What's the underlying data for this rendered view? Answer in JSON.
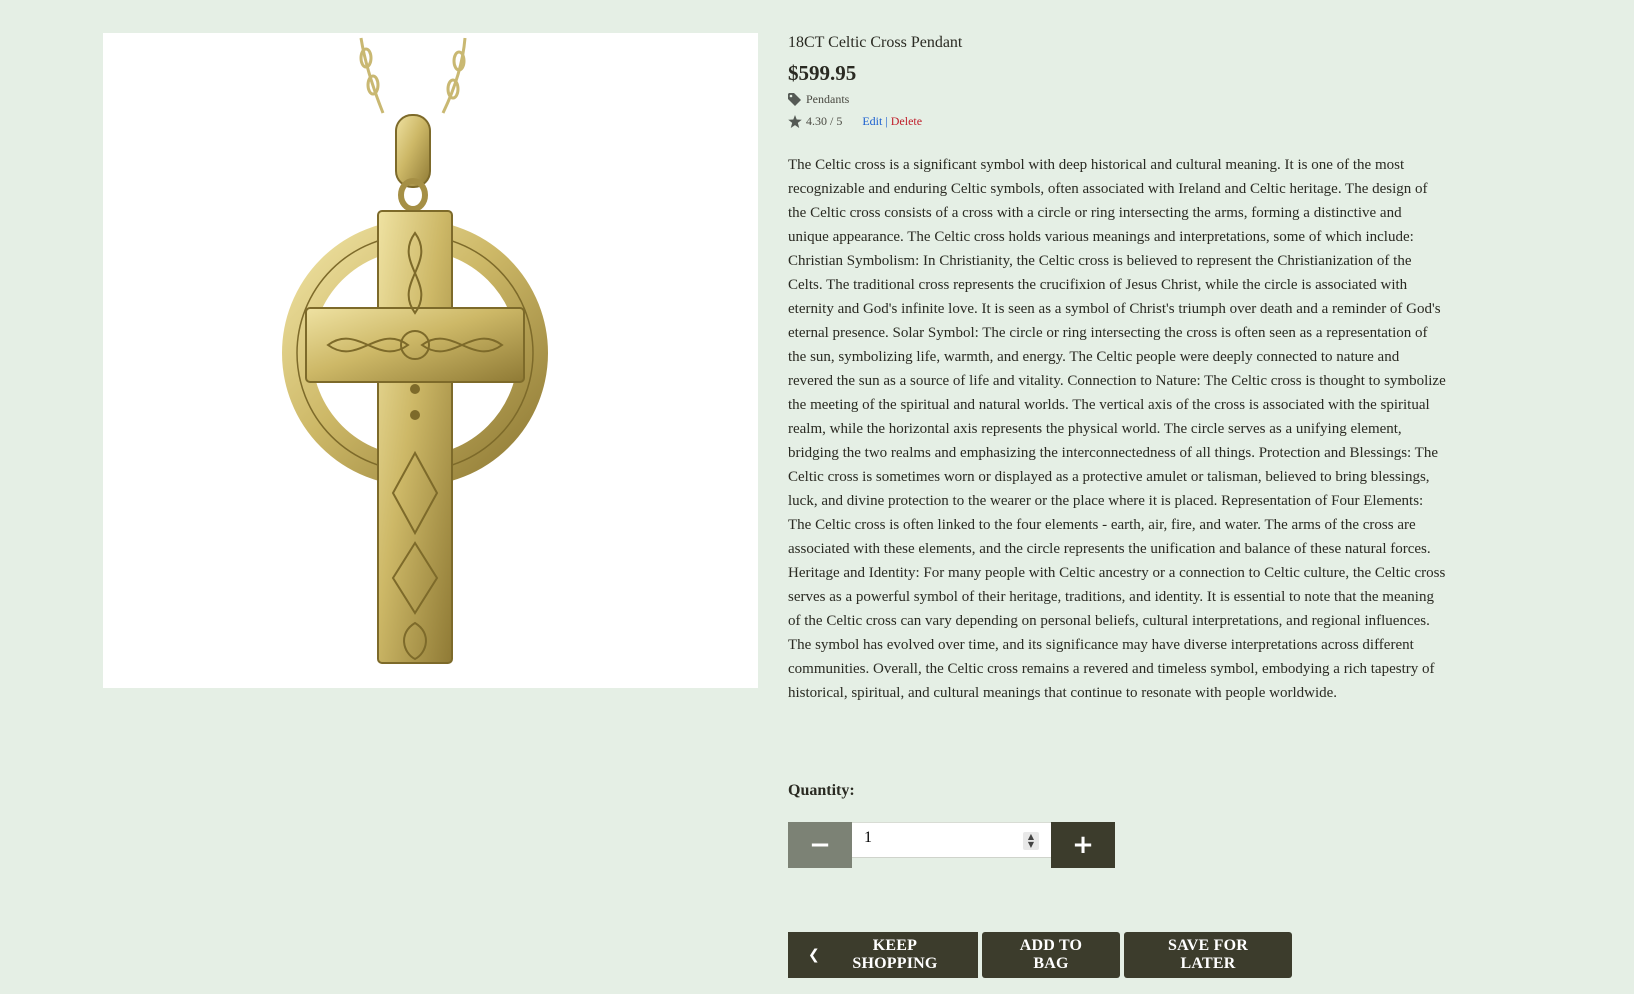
{
  "product": {
    "title": "18CT Celtic Cross Pendant",
    "price": "$599.95",
    "category": "Pendants",
    "rating": "4.30 / 5",
    "edit_label": "Edit",
    "separator": "|",
    "delete_label": "Delete",
    "description": "The Celtic cross is a significant symbol with deep historical and cultural meaning. It is one of the most recognizable and enduring Celtic symbols, often associated with Ireland and Celtic heritage. The design of the Celtic cross consists of a cross with a circle or ring intersecting the arms, forming a distinctive and unique appearance. The Celtic cross holds various meanings and interpretations, some of which include: Christian Symbolism: In Christianity, the Celtic cross is believed to represent the Christianization of the Celts. The traditional cross represents the crucifixion of Jesus Christ, while the circle is associated with eternity and God's infinite love. It is seen as a symbol of Christ's triumph over death and a reminder of God's eternal presence. Solar Symbol: The circle or ring intersecting the cross is often seen as a representation of the sun, symbolizing life, warmth, and energy. The Celtic people were deeply connected to nature and revered the sun as a source of life and vitality. Connection to Nature: The Celtic cross is thought to symbolize the meeting of the spiritual and natural worlds. The vertical axis of the cross is associated with the spiritual realm, while the horizontal axis represents the physical world. The circle serves as a unifying element, bridging the two realms and emphasizing the interconnectedness of all things. Protection and Blessings: The Celtic cross is sometimes worn or displayed as a protective amulet or talisman, believed to bring blessings, luck, and divine protection to the wearer or the place where it is placed. Representation of Four Elements: The Celtic cross is often linked to the four elements - earth, air, fire, and water. The arms of the cross are associated with these elements, and the circle represents the unification and balance of these natural forces. Heritage and Identity: For many people with Celtic ancestry or a connection to Celtic culture, the Celtic cross serves as a powerful symbol of their heritage, traditions, and identity. It is essential to note that the meaning of the Celtic cross can vary depending on personal beliefs, cultural interpretations, and regional influences. The symbol has evolved over time, and its significance may have diverse interpretations across different communities. Overall, the Celtic cross remains a revered and timeless symbol, embodying a rich tapestry of historical, spiritual, and cultural meanings that continue to resonate with people worldwide."
  },
  "icons": {
    "category": "tag-icon",
    "rating": "star-icon",
    "keep_shopping": "chevron-left-icon"
  },
  "quantity": {
    "label": "Quantity:",
    "value": "1",
    "minus_label": "−",
    "plus_label": "+"
  },
  "actions": {
    "keep_shopping": "KEEP SHOPPING",
    "add_to_bag": "ADD TO BAG",
    "save_for_later": "SAVE FOR LATER"
  },
  "colors": {
    "background": "#e5efe5",
    "dark_button": "#3c3c2c",
    "minus_button": "#7c8275",
    "edit_link": "#1a5fd0",
    "delete_link": "#c0202c",
    "gold": "#c9b463"
  }
}
